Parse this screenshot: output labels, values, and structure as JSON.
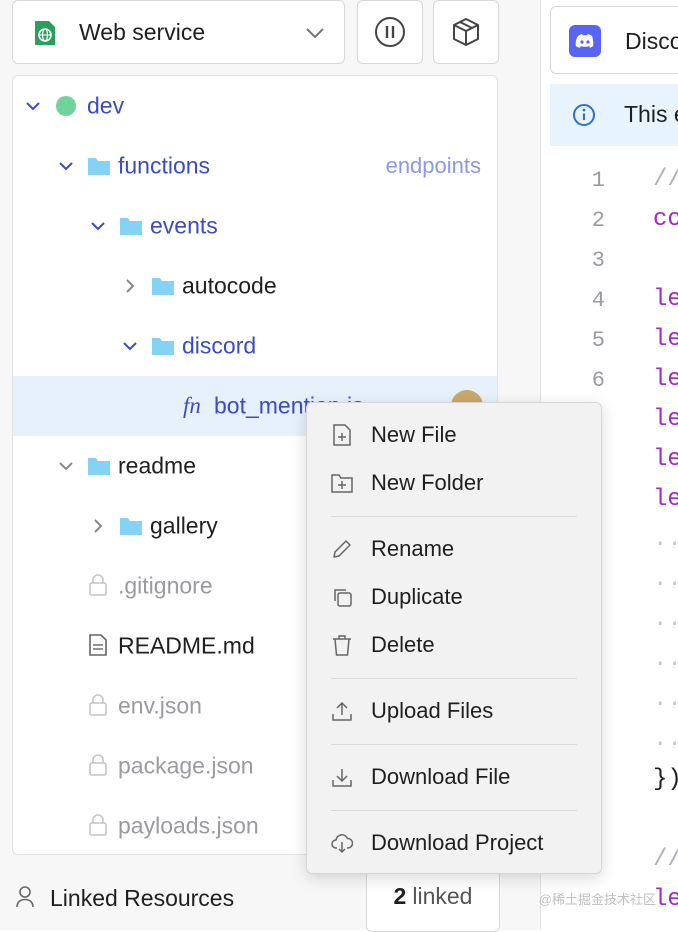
{
  "project": {
    "name": "Web service"
  },
  "tree": {
    "items": [
      {
        "label": "dev"
      },
      {
        "label": "functions",
        "tag": "endpoints"
      },
      {
        "label": "events"
      },
      {
        "label": "autocode"
      },
      {
        "label": "discord"
      },
      {
        "label": "bot_mention.js",
        "prefix": "fn"
      },
      {
        "label": "readme"
      },
      {
        "label": "gallery"
      },
      {
        "label": ".gitignore"
      },
      {
        "label": "README.md"
      },
      {
        "label": "env.json"
      },
      {
        "label": "package.json"
      },
      {
        "label": "payloads.json"
      }
    ]
  },
  "linked": {
    "label": "Linked Resources",
    "count": "2",
    "suffix": "linked"
  },
  "editor": {
    "tab_label": "Discord",
    "banner_text": "This e",
    "line_numbers": [
      "1",
      "2",
      "3",
      "4",
      "5",
      "6"
    ],
    "code_lines": [
      "//",
      "co",
      "",
      "le",
      "le",
      "le",
      "le",
      "le",
      "le",
      "..",
      "..",
      "..",
      "..",
      "..",
      "..",
      "})",
      "",
      "//",
      "le"
    ]
  },
  "context_menu": {
    "items": [
      {
        "label": "New File",
        "icon": "new-file-icon"
      },
      {
        "label": "New Folder",
        "icon": "new-folder-icon"
      },
      {
        "label": "Rename",
        "icon": "pencil-icon"
      },
      {
        "label": "Duplicate",
        "icon": "duplicate-icon"
      },
      {
        "label": "Delete",
        "icon": "trash-icon"
      },
      {
        "label": "Upload Files",
        "icon": "upload-icon"
      },
      {
        "label": "Download File",
        "icon": "download-icon"
      },
      {
        "label": "Download Project",
        "icon": "cloud-download-icon"
      }
    ]
  },
  "watermark": "@稀土掘金技术社区",
  "colors": {
    "accent": "#3b4bc6",
    "selected_row": "#e6f1fb",
    "status_green": "#6fd49a",
    "folder": "#86d2f4",
    "discord": "#5865f2"
  }
}
